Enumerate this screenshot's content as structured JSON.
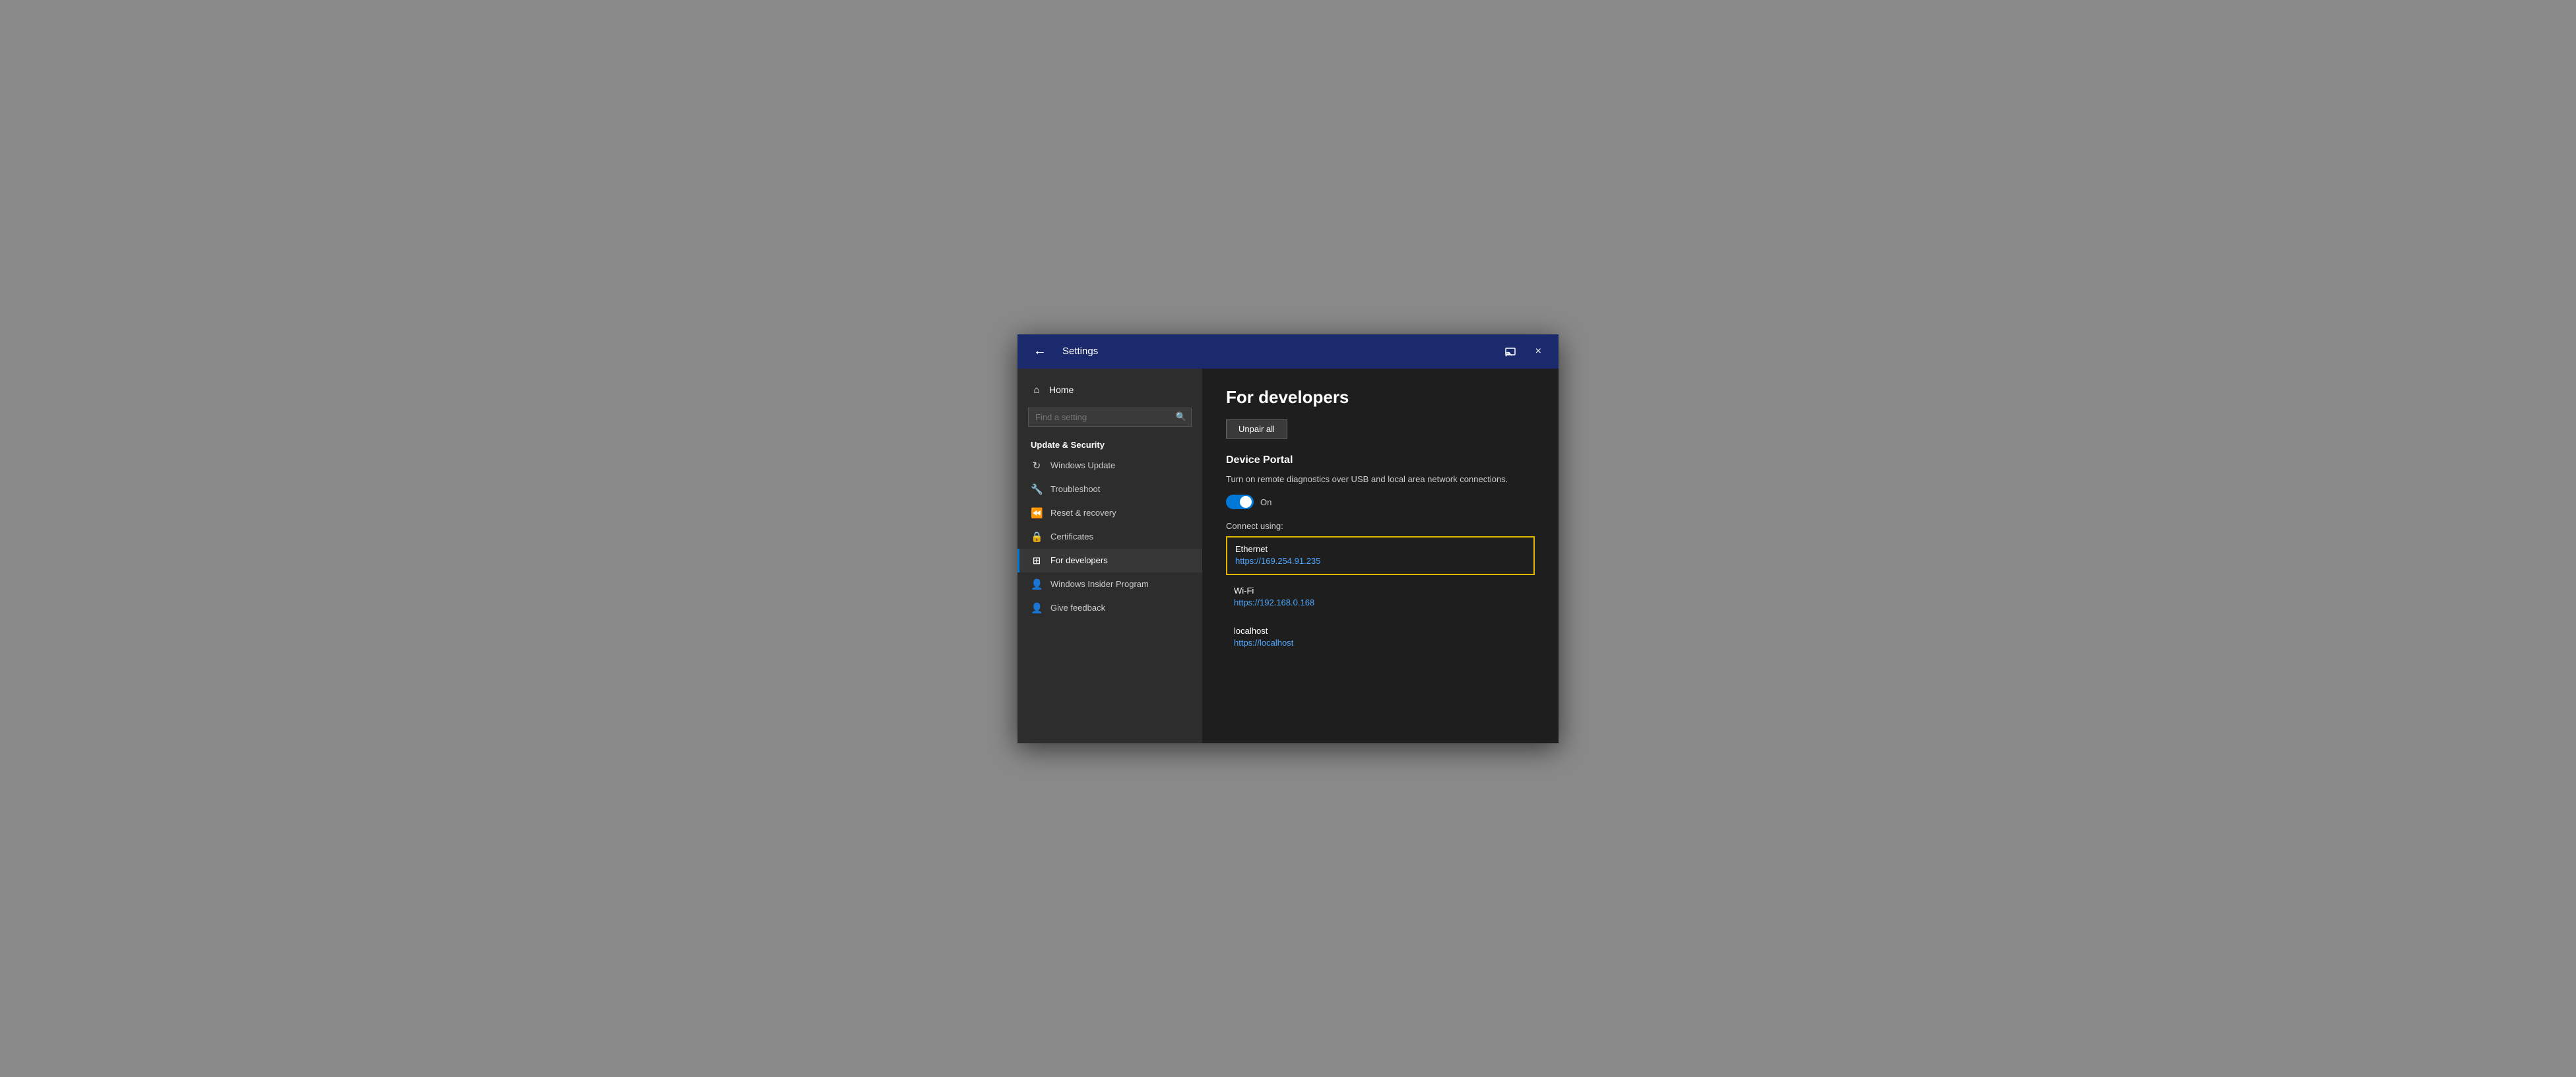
{
  "window": {
    "title": "Settings",
    "back_label": "←",
    "cast_icon": "cast",
    "close_icon": "×"
  },
  "sidebar": {
    "home_label": "Home",
    "home_icon": "⌂",
    "search_placeholder": "Find a setting",
    "search_icon": "🔍",
    "section_label": "Update & Security",
    "items": [
      {
        "id": "windows-update",
        "label": "Windows Update",
        "icon": "↻"
      },
      {
        "id": "troubleshoot",
        "label": "Troubleshoot",
        "icon": "🔧"
      },
      {
        "id": "reset-recovery",
        "label": "Reset & recovery",
        "icon": "⏪"
      },
      {
        "id": "certificates",
        "label": "Certificates",
        "icon": "🔒"
      },
      {
        "id": "for-developers",
        "label": "For developers",
        "icon": "⊞",
        "active": true
      },
      {
        "id": "windows-insider",
        "label": "Windows Insider Program",
        "icon": "👤"
      },
      {
        "id": "give-feedback",
        "label": "Give feedback",
        "icon": "👤"
      }
    ]
  },
  "content": {
    "title": "For developers",
    "unpair_btn": "Unpair all",
    "device_portal": {
      "section_title": "Device Portal",
      "description": "Turn on remote diagnostics over USB and local area network connections.",
      "toggle_state": "On",
      "connect_label": "Connect using:",
      "connections": [
        {
          "id": "ethernet",
          "name": "Ethernet",
          "url": "https://169.254.91.235",
          "highlighted": true
        },
        {
          "id": "wifi",
          "name": "Wi-Fi",
          "url": "https://192.168.0.168",
          "highlighted": false
        },
        {
          "id": "localhost",
          "name": "localhost",
          "url": "https://localhost",
          "highlighted": false
        }
      ]
    }
  }
}
